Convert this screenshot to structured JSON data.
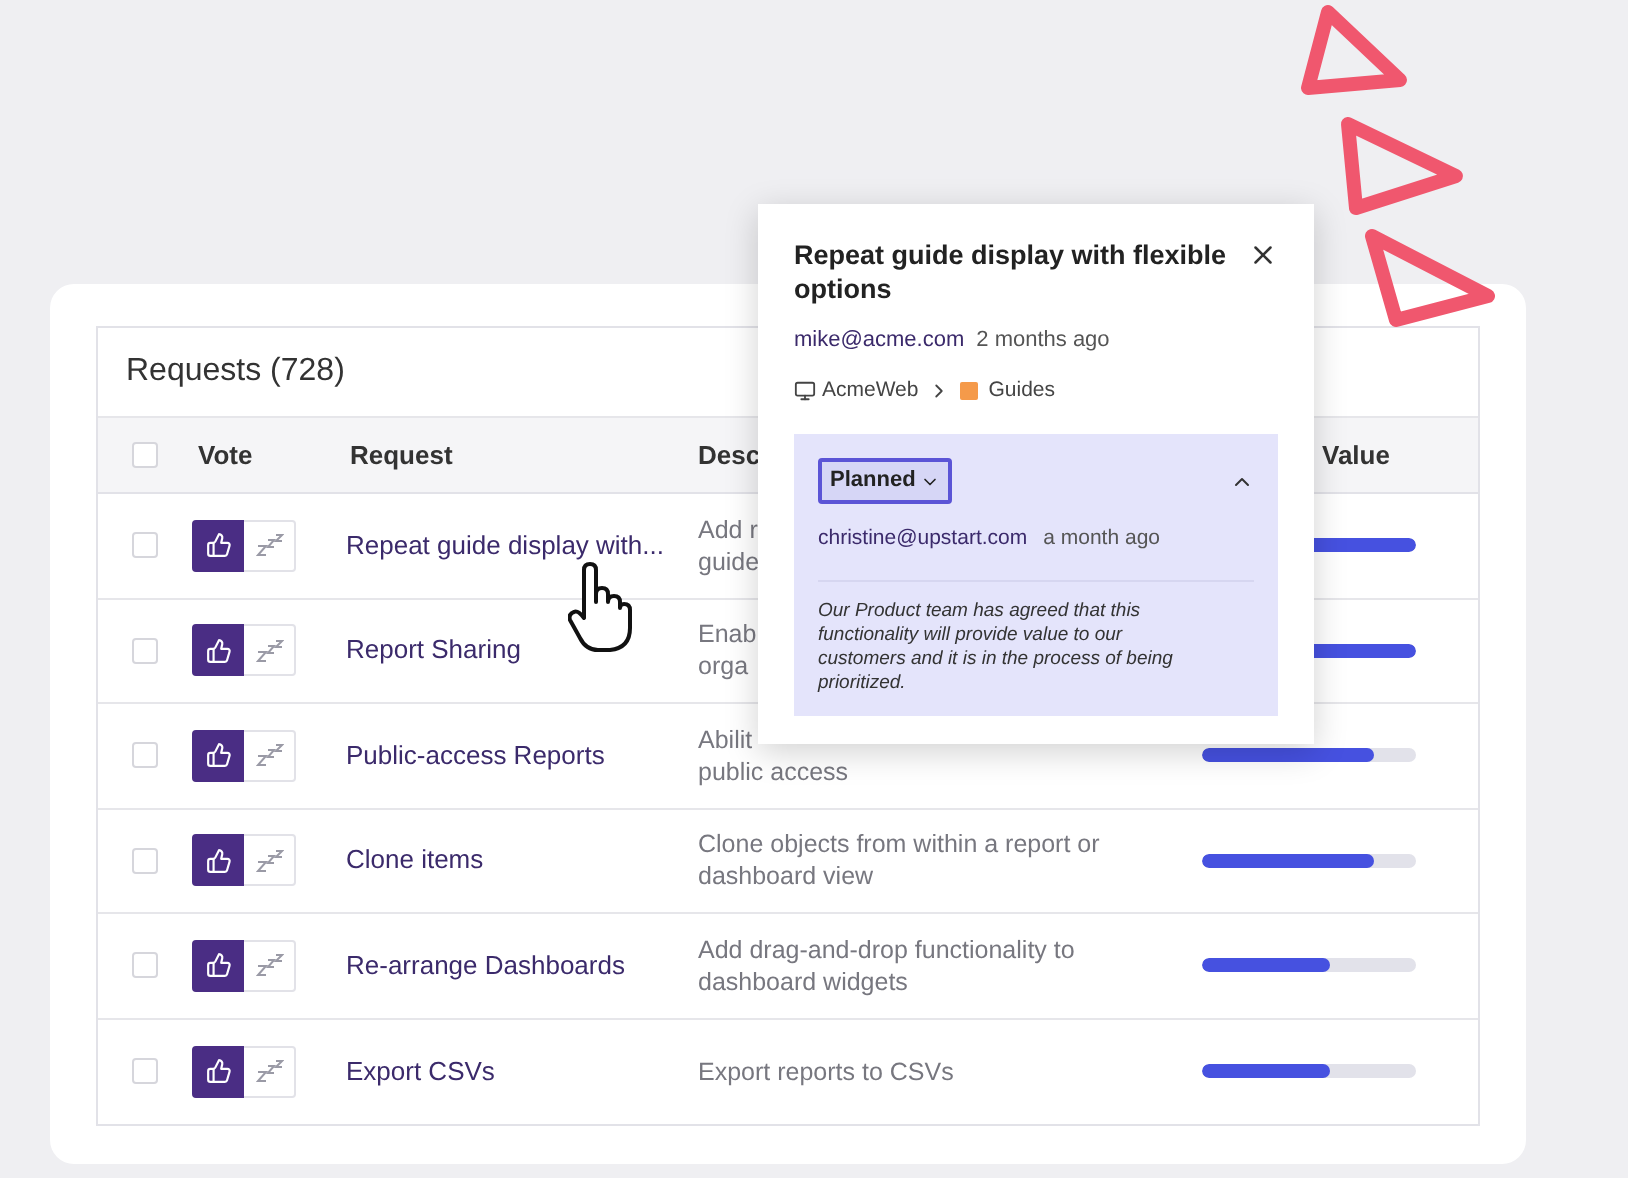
{
  "table": {
    "title": "Requests (728)",
    "select_all": {
      "checked": false
    },
    "columns": [
      "Vote",
      "Request",
      "Desc",
      "Value"
    ],
    "rows": [
      {
        "checked": false,
        "voted": true,
        "request": "Repeat guide display with...",
        "description": [
          "Add r",
          "guide"
        ],
        "level": 1
      },
      {
        "checked": false,
        "voted": true,
        "request": "Report Sharing",
        "description": [
          "Enab",
          "orga"
        ],
        "level": 1
      },
      {
        "checked": false,
        "voted": true,
        "request": "Public-access Reports",
        "description": [
          "Abilit",
          "public access"
        ],
        "level": 0.8
      },
      {
        "checked": false,
        "voted": true,
        "request": "Clone items",
        "description": [
          "Clone objects from within a report or",
          "dashboard view"
        ],
        "level": 0.8
      },
      {
        "checked": false,
        "voted": true,
        "request": "Re-arrange Dashboards",
        "description": [
          "Add drag-and-drop functionality to",
          "dashboard widgets"
        ],
        "level": 0.6
      },
      {
        "checked": false,
        "voted": true,
        "request": "Export CSVs",
        "description": [
          "Export reports to CSVs"
        ],
        "level": 0.6
      }
    ]
  },
  "popover": {
    "title": "Repeat guide display with flexible options",
    "author": "mike@acme.com",
    "time": "2 months ago",
    "breadcrumb": [
      "AcmeWeb",
      "Guides"
    ],
    "status": {
      "label": "Planned",
      "expanded": true,
      "author": "christine@upstart.com",
      "time": "a month ago",
      "comment": "Our Product team has agreed that this functionality will provide value to our customers and it is in the process of being prioritized."
    }
  }
}
